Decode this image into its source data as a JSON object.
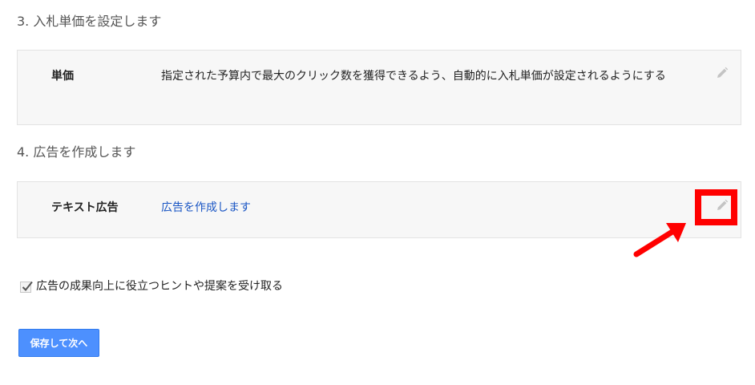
{
  "sections": {
    "bid": {
      "heading": "3. 入札単価を設定します",
      "label": "単価",
      "value": "指定された予算内で最大のクリック数を獲得できるよう、自動的に入札単価が設定されるようにする",
      "edit_icon": "pencil-icon"
    },
    "ad": {
      "heading": "4. 広告を作成します",
      "label": "テキスト広告",
      "link": "広告を作成します",
      "edit_icon": "pencil-icon"
    }
  },
  "options": {
    "hints_checkbox_label": "広告の成果向上に役立つヒントや提案を受け取る",
    "hints_checked": true
  },
  "actions": {
    "save_next_label": "保存して次へ"
  },
  "annotation": {
    "highlight_color": "#ff0000"
  },
  "colors": {
    "link": "#1a56c4",
    "primary_button": "#4d90fe",
    "card_background": "#f7f7f7"
  }
}
